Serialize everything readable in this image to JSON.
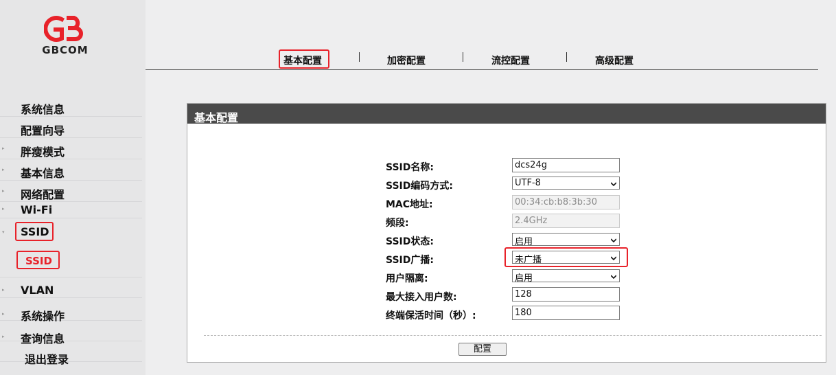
{
  "brand": {
    "name": "GBCOM",
    "accent": "#e8222a"
  },
  "sidebar": {
    "items": [
      {
        "label": "系统信息",
        "arrow": false
      },
      {
        "label": "配置向导",
        "arrow": false
      },
      {
        "label": "胖瘦模式",
        "arrow": true
      },
      {
        "label": "基本信息",
        "arrow": true
      },
      {
        "label": "网络配置",
        "arrow": true
      },
      {
        "label": "Wi-Fi",
        "arrow": true
      },
      {
        "label": "SSID",
        "arrow": true,
        "expanded": true
      },
      {
        "label": "SSID",
        "sub": true
      },
      {
        "label": "VLAN",
        "arrow": true
      },
      {
        "label": "系统操作",
        "arrow": true
      },
      {
        "label": "查询信息",
        "arrow": true
      },
      {
        "label": "退出登录",
        "arrow": false
      }
    ]
  },
  "tabs": [
    {
      "label": "基本配置",
      "active": true
    },
    {
      "label": "加密配置"
    },
    {
      "label": "流控配置"
    },
    {
      "label": "高级配置"
    }
  ],
  "panel": {
    "title": "基本配置",
    "rows": [
      {
        "label": "SSID名称:",
        "value": "dcs24g",
        "type": "text"
      },
      {
        "label": "SSID编码方式:",
        "value": "UTF-8",
        "type": "select"
      },
      {
        "label": "MAC地址:",
        "value": "00:34:cb:b8:3b:30",
        "type": "readonly"
      },
      {
        "label": "频段:",
        "value": "2.4GHz",
        "type": "readonly"
      },
      {
        "label": "SSID状态:",
        "value": "启用",
        "type": "select"
      },
      {
        "label": "SSID广播:",
        "value": "未广播",
        "type": "select"
      },
      {
        "label": "用户隔离:",
        "value": "启用",
        "type": "select"
      },
      {
        "label": "最大接入用户数:",
        "value": "128",
        "type": "text"
      },
      {
        "label": "终端保活时间（秒）:",
        "value": "180",
        "type": "text"
      }
    ],
    "submit_label": "配置"
  }
}
